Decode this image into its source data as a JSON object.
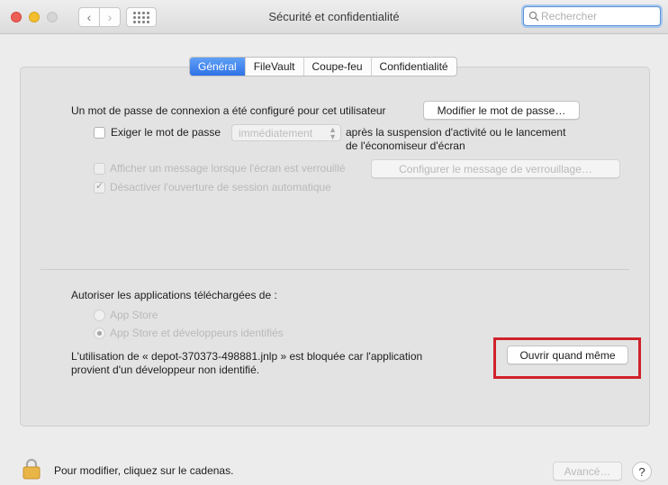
{
  "window": {
    "title": "Sécurité et confidentialité",
    "search_placeholder": "Rechercher"
  },
  "tabs": [
    {
      "label": "Général",
      "active": true
    },
    {
      "label": "FileVault",
      "active": false
    },
    {
      "label": "Coupe-feu",
      "active": false
    },
    {
      "label": "Confidentialité",
      "active": false
    }
  ],
  "general": {
    "password_text": "Un mot de passe de connexion a été configuré pour cet utilisateur",
    "change_password_button": "Modifier le mot de passe…",
    "require_password_label": "Exiger le mot de passe",
    "require_password_delay": "immédiatement",
    "require_password_suffix_line1": "après la suspension d'activité ou le lancement",
    "require_password_suffix_line2": "de l'économiseur d'écran",
    "show_message_label": "Afficher un message lorsque l'écran est verrouillé",
    "configure_message_button": "Configurer le message de verrouillage…",
    "disable_autologin_label": "Désactiver l'ouverture de session automatique"
  },
  "apps": {
    "heading": "Autoriser les applications téléchargées de :",
    "option_app_store": "App Store",
    "option_identified": "App Store et développeurs identifiés",
    "blocked_line1": "L'utilisation de « depot-370373-498881.jnlp » est bloquée car l'application",
    "blocked_line2": "provient d'un développeur non identifié.",
    "open_anyway_button": "Ouvrir quand même"
  },
  "footer": {
    "lock_text": "Pour modifier, cliquez sur le cadenas.",
    "advanced_button": "Avancé…",
    "help_label": "?"
  },
  "colors": {
    "tab_active": "#2f72e6",
    "highlight_box": "#d0222b"
  }
}
